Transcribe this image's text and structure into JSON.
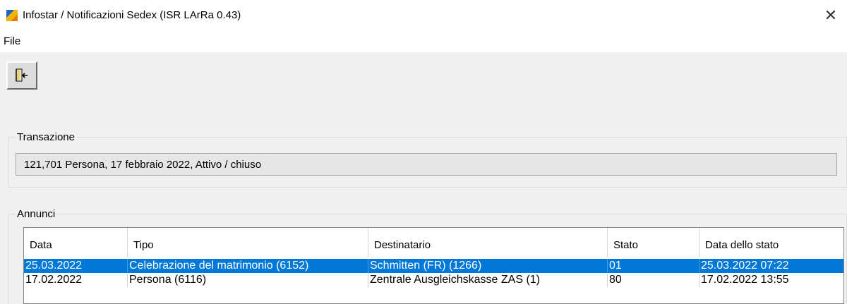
{
  "window": {
    "title": "Infostar / Notificazioni Sedex (ISR LArRa 0.43)",
    "close_glyph": "✕"
  },
  "menu": {
    "file": "File"
  },
  "toolbar": {
    "exit_icon": "exit-door-icon"
  },
  "transaction": {
    "legend": "Transazione",
    "value": "121,701  Persona, 17 febbraio 2022, Attivo / chiuso"
  },
  "announcements": {
    "legend": "Annunci",
    "columns": [
      "Data",
      "Tipo",
      "Destinatario",
      "Stato",
      "Data dello stato"
    ],
    "rows": [
      {
        "data": "25.03.2022",
        "tipo": "Celebrazione del matrimonio (6152)",
        "destinatario": "Schmitten (FR) (1266)",
        "stato": "01",
        "data_stato": "25.03.2022 07:22",
        "selected": true
      },
      {
        "data": "17.02.2022",
        "tipo": "Persona (6116)",
        "destinatario": "Zentrale Ausgleichskasse ZAS (1)",
        "stato": "80",
        "data_stato": "17.02.2022 13:55",
        "selected": false
      }
    ]
  },
  "colors": {
    "selection": "#0078d7"
  }
}
